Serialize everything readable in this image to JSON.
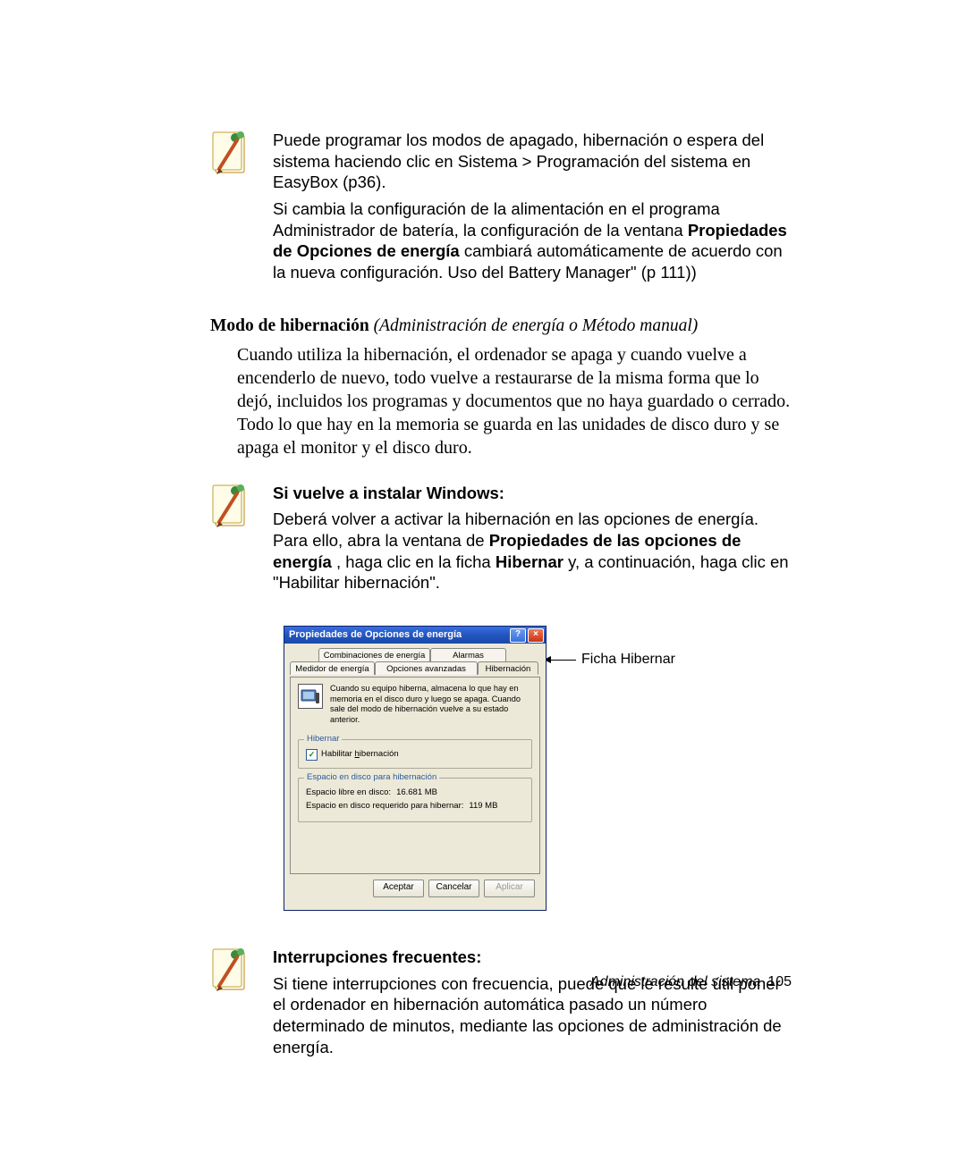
{
  "note1_p1": "Puede programar los modos de apagado, hibernación o espera del sistema haciendo clic en Sistema > Programación del sistema en EasyBox (p36).",
  "note1_p2_a": "Si cambia la configuración de la alimentación en el programa Administrador de batería, la configuración de la ventana ",
  "note1_p2_bold": "Propiedades de Opciones de energía",
  "note1_p2_b": " cambiará automáticamente de acuerdo con la nueva configuración. Uso del Battery Manager\" (p 111))",
  "heading_bold": "Modo de hibernación",
  "heading_italic": " (Administración de energía o Método manual)",
  "body1": "Cuando utiliza la hibernación, el ordenador se apaga y cuando vuelve a encenderlo de nuevo, todo vuelve a restaurarse de la misma forma que lo dejó, incluidos los programas y documentos que no haya guardado o cerrado. Todo lo que hay en la memoria se guarda en las unidades de disco duro y se apaga el monitor y el disco duro.",
  "note2_title": "Si vuelve a instalar Windows:",
  "note2_body_a": "Deberá volver a activar la hibernación en las opciones de energía. Para ello, abra la ventana de ",
  "note2_body_bold1": "Propiedades de las opciones de energía",
  "note2_body_b": " , haga clic en la ficha ",
  "note2_body_bold2": "Hibernar",
  "note2_body_c": " y, a continuación, haga clic en \"Habilitar hibernación\".",
  "dialog": {
    "title": "Propiedades de Opciones de energía",
    "tabs": {
      "row1a": "Combinaciones de energía",
      "row1b": "Alarmas",
      "row2a": "Medidor de energía",
      "row2b": "Opciones avanzadas",
      "active": "Hibernación"
    },
    "desc": "Cuando su equipo hiberna, almacena lo que hay en memoria en el disco duro y luego se apaga. Cuando sale del modo de hibernación vuelve a su estado anterior.",
    "group1": "Hibernar",
    "checkbox_prefix": "Habilitar ",
    "checkbox_under": "h",
    "checkbox_suffix": "ibernación",
    "group2": "Espacio en disco para hibernación",
    "free_label": "Espacio libre en disco:",
    "free_value": "16.681 MB",
    "req_label": "Espacio en disco requerido para hibernar:",
    "req_value": "119 MB",
    "btn_ok": "Aceptar",
    "btn_cancel": "Cancelar",
    "btn_apply": "Aplicar"
  },
  "callout": "Ficha Hibernar",
  "note3_title": "Interrupciones frecuentes:",
  "note3_body": "Si tiene interrupciones con frecuencia, puede que le resulte útil poner el ordenador en hibernación automática pasado un número determinado de minutos, mediante las opciones de administración de energía.",
  "footer_text": "Administración del sistema",
  "footer_page": "105"
}
